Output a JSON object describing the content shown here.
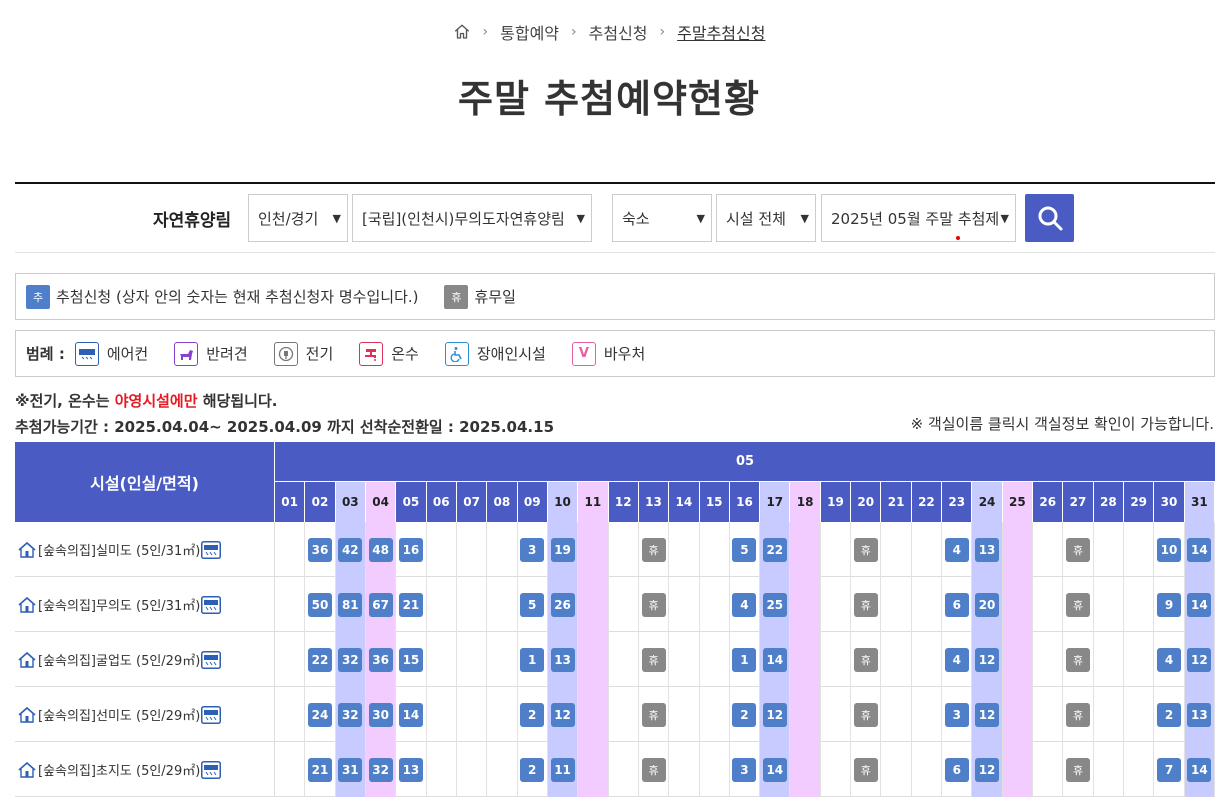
{
  "breadcrumb": [
    "통합예약",
    "추첨신청",
    "주말추첨신청"
  ],
  "page_title": "주말 추첨예약현황",
  "filters": {
    "label": "자연휴양림",
    "region": "인천/경기",
    "forest": "[국립](인천시)무의도자연휴양림",
    "type": "숙소",
    "facility": "시설 전체",
    "period": "2025년 05월 주말 추첨제"
  },
  "legend_status": {
    "lottery_chip": "추",
    "lottery_text": "추첨신청 (상자 안의 숫자는 현재 추첨신청자 명수입니다.)",
    "rest_chip": "휴",
    "rest_text": "휴무일"
  },
  "legend_amenities": {
    "title": "범례 :",
    "items": [
      {
        "label": "에어컨",
        "icon": "air-conditioner-icon",
        "color": "#2d5fb5"
      },
      {
        "label": "반려견",
        "icon": "dog-icon",
        "color": "#8a3fd1"
      },
      {
        "label": "전기",
        "icon": "plug-icon",
        "color": "#777777"
      },
      {
        "label": "온수",
        "icon": "hot-water-icon",
        "color": "#e0305a"
      },
      {
        "label": "장애인시설",
        "icon": "wheelchair-icon",
        "color": "#2b8fd6"
      },
      {
        "label": "바우처",
        "icon": "voucher-icon",
        "color": "#e75fa0",
        "glyph": "V"
      }
    ]
  },
  "notices": {
    "line1_prefix": "※전기, 온수는 ",
    "line1_red": "야영시설에만",
    "line1_suffix": " 해당됩니다.",
    "line2": "추첨가능기간 : 2025.04.04~ 2025.04.09 까지 선착순전환일 : 2025.04.15",
    "line3": "※ 객실이름 클릭시 객실정보 확인이 가능합니다."
  },
  "table": {
    "facility_header": "시설(인실/면적)",
    "month": "05",
    "days": [
      "01",
      "02",
      "03",
      "04",
      "05",
      "06",
      "07",
      "08",
      "09",
      "10",
      "11",
      "12",
      "13",
      "14",
      "15",
      "16",
      "17",
      "18",
      "19",
      "20",
      "21",
      "22",
      "23",
      "24",
      "25",
      "26",
      "27",
      "28",
      "29",
      "30",
      "31"
    ],
    "saturdays": [
      "03",
      "10",
      "17",
      "24",
      "31"
    ],
    "sundays": [
      "04",
      "11",
      "18",
      "25"
    ],
    "rest_label": "휴",
    "rows": [
      {
        "name": "[숲속의집]실미도 (5인/31㎡)",
        "cells": {
          "02": "36",
          "03": "42",
          "04": "48",
          "05": "16",
          "09": "3",
          "10": "19",
          "13": "휴",
          "16": "5",
          "17": "22",
          "20": "휴",
          "23": "4",
          "24": "13",
          "27": "휴",
          "30": "10",
          "31": "14"
        }
      },
      {
        "name": "[숲속의집]무의도 (5인/31㎡)",
        "cells": {
          "02": "50",
          "03": "81",
          "04": "67",
          "05": "21",
          "09": "5",
          "10": "26",
          "13": "휴",
          "16": "4",
          "17": "25",
          "20": "휴",
          "23": "6",
          "24": "20",
          "27": "휴",
          "30": "9",
          "31": "14"
        }
      },
      {
        "name": "[숲속의집]굴업도 (5인/29㎡)",
        "cells": {
          "02": "22",
          "03": "32",
          "04": "36",
          "05": "15",
          "09": "1",
          "10": "13",
          "13": "휴",
          "16": "1",
          "17": "14",
          "20": "휴",
          "23": "4",
          "24": "12",
          "27": "휴",
          "30": "4",
          "31": "12"
        }
      },
      {
        "name": "[숲속의집]선미도 (5인/29㎡)",
        "cells": {
          "02": "24",
          "03": "32",
          "04": "30",
          "05": "14",
          "09": "2",
          "10": "12",
          "13": "휴",
          "16": "2",
          "17": "12",
          "20": "휴",
          "23": "3",
          "24": "12",
          "27": "휴",
          "30": "2",
          "31": "13"
        }
      },
      {
        "name": "[숲속의집]초지도 (5인/29㎡)",
        "cells": {
          "02": "21",
          "03": "31",
          "04": "32",
          "05": "13",
          "09": "2",
          "10": "11",
          "13": "휴",
          "16": "3",
          "17": "14",
          "20": "휴",
          "23": "6",
          "24": "12",
          "27": "휴",
          "30": "7",
          "31": "14"
        }
      }
    ]
  }
}
